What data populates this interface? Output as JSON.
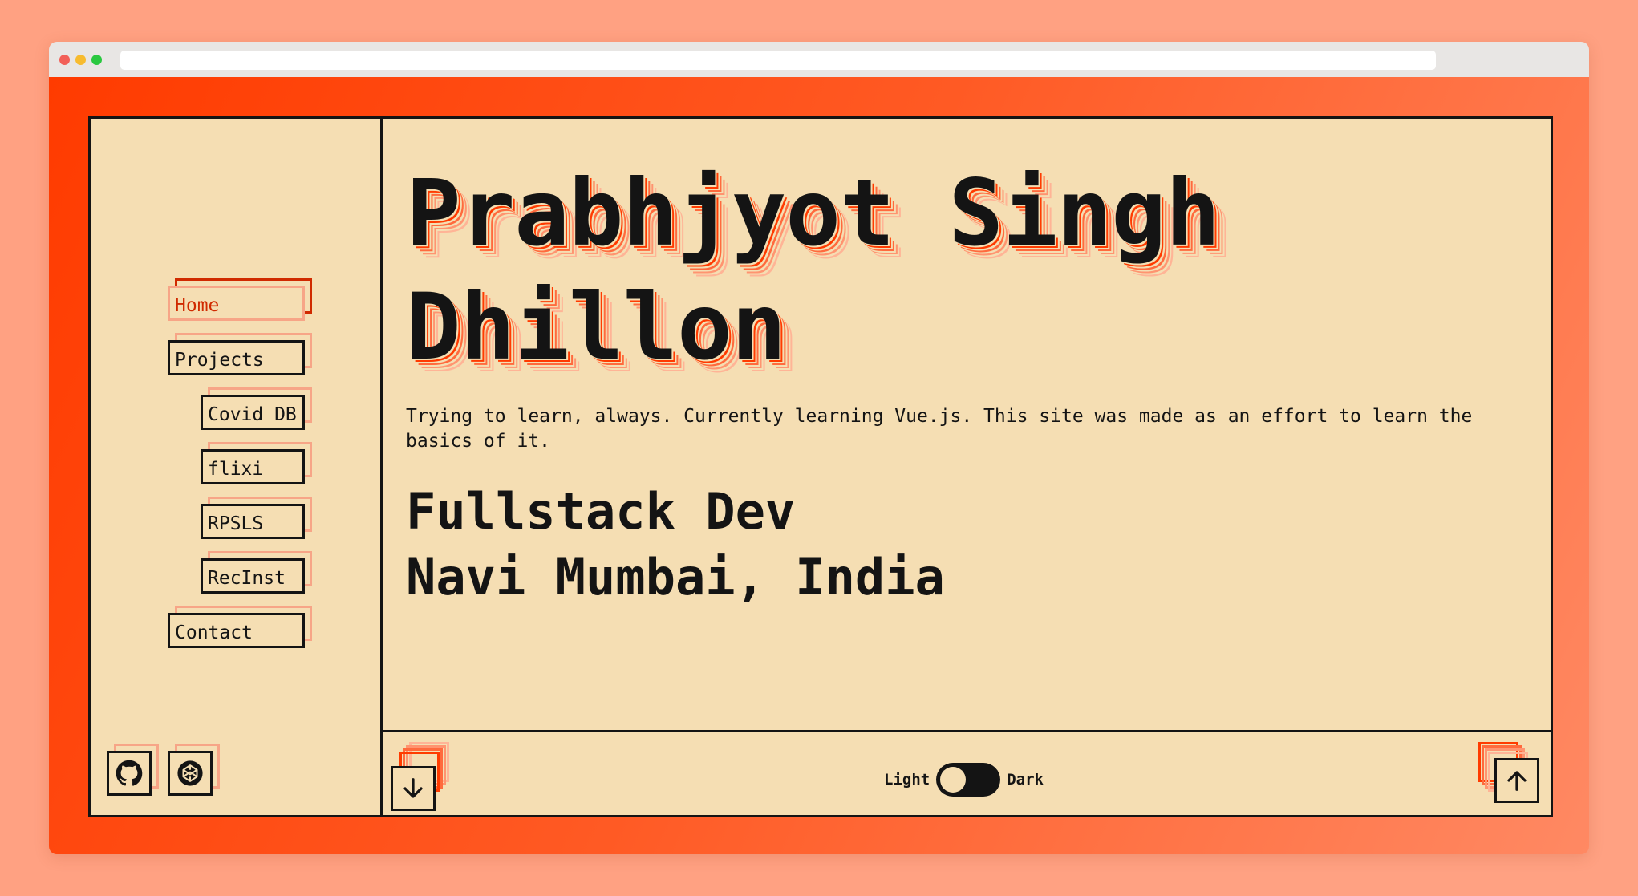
{
  "nav": {
    "items": [
      {
        "label": "Home",
        "active": true
      },
      {
        "label": "Projects"
      },
      {
        "label": "Covid DB"
      },
      {
        "label": "flixi"
      },
      {
        "label": "RPSLS"
      },
      {
        "label": "RecInst"
      },
      {
        "label": "Contact"
      }
    ]
  },
  "social": {
    "github_icon": "github-icon",
    "codepen_icon": "codepen-icon"
  },
  "hero": {
    "name_line1": "Prabhjyot Singh",
    "name_line2": "Dhillon",
    "intro": "Trying to learn, always. Currently learning Vue.js. This site was made as an effort to learn the basics of it.",
    "role": "Fullstack Dev",
    "location": "Navi Mumbai, India"
  },
  "footer": {
    "theme_light_label": "Light",
    "theme_dark_label": "Dark",
    "theme_dark_enabled": false,
    "scroll_down_icon": "arrow-down-icon",
    "scroll_up_icon": "arrow-up-icon"
  },
  "colors": {
    "background": "#f5deb3",
    "accent": "#ff3b00",
    "accent_light": "#f7a587",
    "ink": "#141414"
  }
}
